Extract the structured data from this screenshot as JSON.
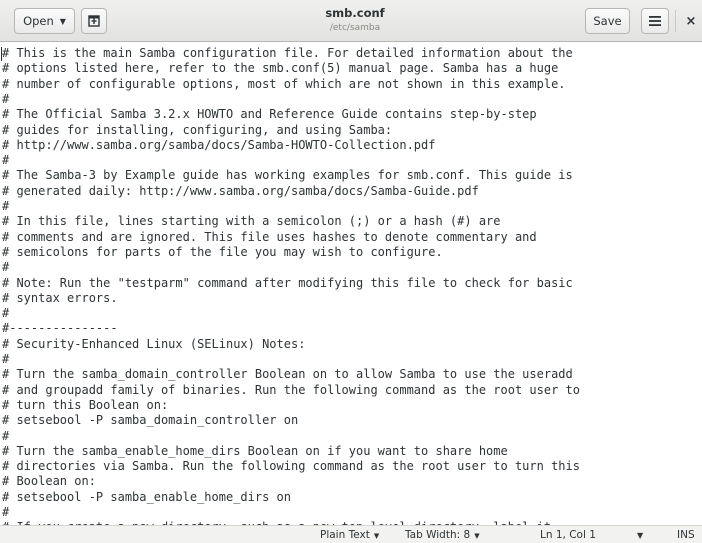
{
  "header": {
    "open_label": "Open",
    "new_tab_icon": "new-document-icon",
    "title": "smb.conf",
    "subtitle": "/etc/samba",
    "save_label": "Save",
    "menu_icon": "hamburger-menu-icon",
    "close_icon": "close-icon"
  },
  "editor": {
    "lines": [
      "# This is the main Samba configuration file. For detailed information about the",
      "# options listed here, refer to the smb.conf(5) manual page. Samba has a huge",
      "# number of configurable options, most of which are not shown in this example.",
      "#",
      "# The Official Samba 3.2.x HOWTO and Reference Guide contains step-by-step",
      "# guides for installing, configuring, and using Samba:",
      "# http://www.samba.org/samba/docs/Samba-HOWTO-Collection.pdf",
      "#",
      "# The Samba-3 by Example guide has working examples for smb.conf. This guide is",
      "# generated daily: http://www.samba.org/samba/docs/Samba-Guide.pdf",
      "#",
      "# In this file, lines starting with a semicolon (;) or a hash (#) are",
      "# comments and are ignored. This file uses hashes to denote commentary and",
      "# semicolons for parts of the file you may wish to configure.",
      "#",
      "# Note: Run the \"testparm\" command after modifying this file to check for basic",
      "# syntax errors.",
      "#",
      "#---------------",
      "# Security-Enhanced Linux (SELinux) Notes:",
      "#",
      "# Turn the samba_domain_controller Boolean on to allow Samba to use the useradd",
      "# and groupadd family of binaries. Run the following command as the root user to",
      "# turn this Boolean on:",
      "# setsebool -P samba_domain_controller on",
      "#",
      "# Turn the samba_enable_home_dirs Boolean on if you want to share home",
      "# directories via Samba. Run the following command as the root user to turn this",
      "# Boolean on:",
      "# setsebool -P samba_enable_home_dirs on",
      "#",
      "# If you create a new directory, such as a new top-level directory, label it"
    ]
  },
  "statusbar": {
    "language": "Plain Text",
    "tab_width": "Tab Width: 8",
    "position": "Ln 1, Col 1",
    "mode": "INS"
  }
}
